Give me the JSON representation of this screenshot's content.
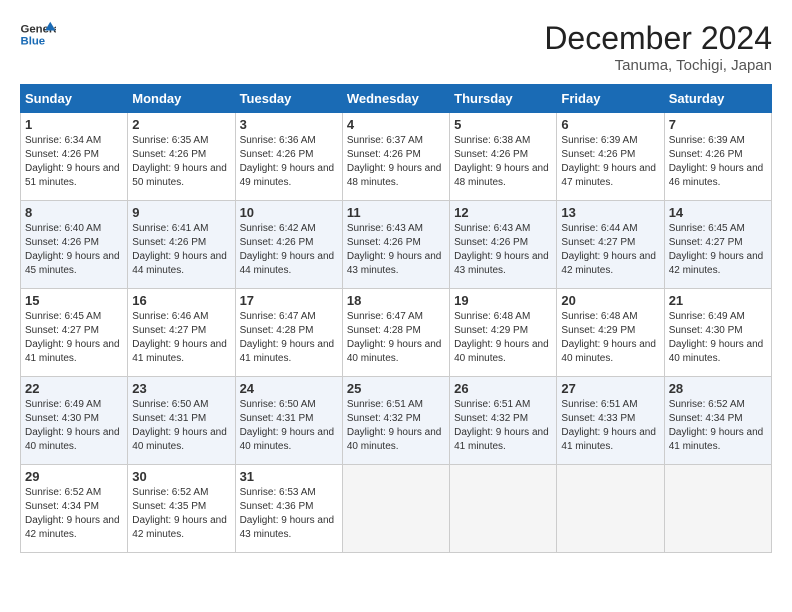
{
  "header": {
    "logo_line1": "General",
    "logo_line2": "Blue",
    "month_title": "December 2024",
    "location": "Tanuma, Tochigi, Japan"
  },
  "days_of_week": [
    "Sunday",
    "Monday",
    "Tuesday",
    "Wednesday",
    "Thursday",
    "Friday",
    "Saturday"
  ],
  "weeks": [
    [
      {
        "day": 1,
        "sunrise": "6:34 AM",
        "sunset": "4:26 PM",
        "daylight": "9 hours and 51 minutes."
      },
      {
        "day": 2,
        "sunrise": "6:35 AM",
        "sunset": "4:26 PM",
        "daylight": "9 hours and 50 minutes."
      },
      {
        "day": 3,
        "sunrise": "6:36 AM",
        "sunset": "4:26 PM",
        "daylight": "9 hours and 49 minutes."
      },
      {
        "day": 4,
        "sunrise": "6:37 AM",
        "sunset": "4:26 PM",
        "daylight": "9 hours and 48 minutes."
      },
      {
        "day": 5,
        "sunrise": "6:38 AM",
        "sunset": "4:26 PM",
        "daylight": "9 hours and 48 minutes."
      },
      {
        "day": 6,
        "sunrise": "6:39 AM",
        "sunset": "4:26 PM",
        "daylight": "9 hours and 47 minutes."
      },
      {
        "day": 7,
        "sunrise": "6:39 AM",
        "sunset": "4:26 PM",
        "daylight": "9 hours and 46 minutes."
      }
    ],
    [
      {
        "day": 8,
        "sunrise": "6:40 AM",
        "sunset": "4:26 PM",
        "daylight": "9 hours and 45 minutes."
      },
      {
        "day": 9,
        "sunrise": "6:41 AM",
        "sunset": "4:26 PM",
        "daylight": "9 hours and 44 minutes."
      },
      {
        "day": 10,
        "sunrise": "6:42 AM",
        "sunset": "4:26 PM",
        "daylight": "9 hours and 44 minutes."
      },
      {
        "day": 11,
        "sunrise": "6:43 AM",
        "sunset": "4:26 PM",
        "daylight": "9 hours and 43 minutes."
      },
      {
        "day": 12,
        "sunrise": "6:43 AM",
        "sunset": "4:26 PM",
        "daylight": "9 hours and 43 minutes."
      },
      {
        "day": 13,
        "sunrise": "6:44 AM",
        "sunset": "4:27 PM",
        "daylight": "9 hours and 42 minutes."
      },
      {
        "day": 14,
        "sunrise": "6:45 AM",
        "sunset": "4:27 PM",
        "daylight": "9 hours and 42 minutes."
      }
    ],
    [
      {
        "day": 15,
        "sunrise": "6:45 AM",
        "sunset": "4:27 PM",
        "daylight": "9 hours and 41 minutes."
      },
      {
        "day": 16,
        "sunrise": "6:46 AM",
        "sunset": "4:27 PM",
        "daylight": "9 hours and 41 minutes."
      },
      {
        "day": 17,
        "sunrise": "6:47 AM",
        "sunset": "4:28 PM",
        "daylight": "9 hours and 41 minutes."
      },
      {
        "day": 18,
        "sunrise": "6:47 AM",
        "sunset": "4:28 PM",
        "daylight": "9 hours and 40 minutes."
      },
      {
        "day": 19,
        "sunrise": "6:48 AM",
        "sunset": "4:29 PM",
        "daylight": "9 hours and 40 minutes."
      },
      {
        "day": 20,
        "sunrise": "6:48 AM",
        "sunset": "4:29 PM",
        "daylight": "9 hours and 40 minutes."
      },
      {
        "day": 21,
        "sunrise": "6:49 AM",
        "sunset": "4:30 PM",
        "daylight": "9 hours and 40 minutes."
      }
    ],
    [
      {
        "day": 22,
        "sunrise": "6:49 AM",
        "sunset": "4:30 PM",
        "daylight": "9 hours and 40 minutes."
      },
      {
        "day": 23,
        "sunrise": "6:50 AM",
        "sunset": "4:31 PM",
        "daylight": "9 hours and 40 minutes."
      },
      {
        "day": 24,
        "sunrise": "6:50 AM",
        "sunset": "4:31 PM",
        "daylight": "9 hours and 40 minutes."
      },
      {
        "day": 25,
        "sunrise": "6:51 AM",
        "sunset": "4:32 PM",
        "daylight": "9 hours and 40 minutes."
      },
      {
        "day": 26,
        "sunrise": "6:51 AM",
        "sunset": "4:32 PM",
        "daylight": "9 hours and 41 minutes."
      },
      {
        "day": 27,
        "sunrise": "6:51 AM",
        "sunset": "4:33 PM",
        "daylight": "9 hours and 41 minutes."
      },
      {
        "day": 28,
        "sunrise": "6:52 AM",
        "sunset": "4:34 PM",
        "daylight": "9 hours and 41 minutes."
      }
    ],
    [
      {
        "day": 29,
        "sunrise": "6:52 AM",
        "sunset": "4:34 PM",
        "daylight": "9 hours and 42 minutes."
      },
      {
        "day": 30,
        "sunrise": "6:52 AM",
        "sunset": "4:35 PM",
        "daylight": "9 hours and 42 minutes."
      },
      {
        "day": 31,
        "sunrise": "6:53 AM",
        "sunset": "4:36 PM",
        "daylight": "9 hours and 43 minutes."
      },
      null,
      null,
      null,
      null
    ]
  ],
  "labels": {
    "sunrise": "Sunrise:",
    "sunset": "Sunset:",
    "daylight": "Daylight:"
  }
}
